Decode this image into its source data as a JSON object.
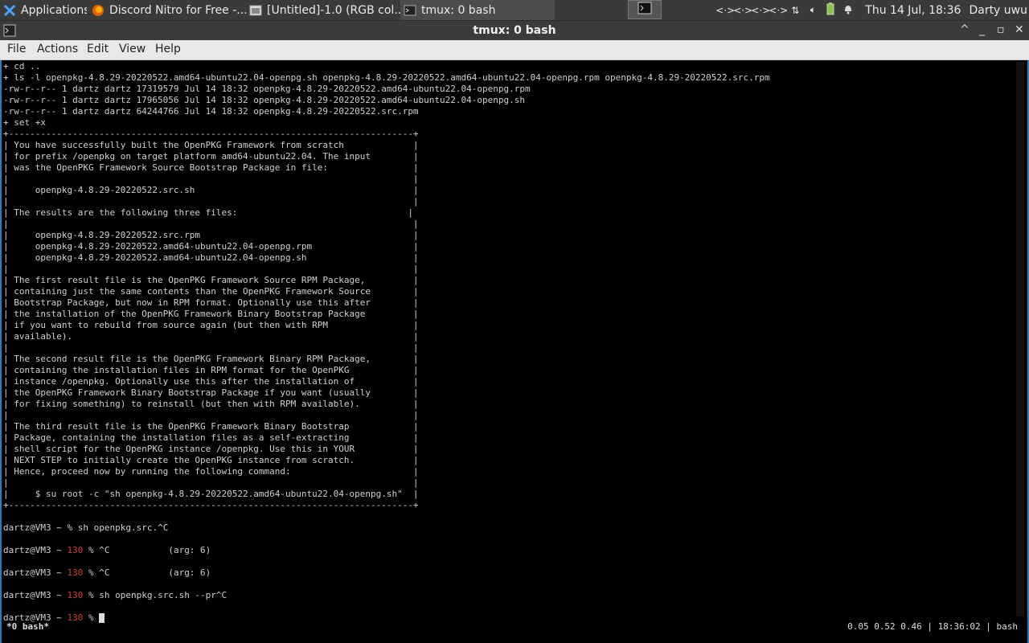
{
  "panel": {
    "tasks": [
      {
        "label": "Applications"
      },
      {
        "label": "Discord Nitro for Free -..."
      },
      {
        "label": "[Untitled]-1.0 (RGB col..."
      },
      {
        "label": "tmux: 0 bash"
      }
    ],
    "clock": "Thu 14 Jul, 18:36",
    "user": "Darty uwu"
  },
  "window": {
    "title": "tmux: 0 bash",
    "menu": [
      "File",
      "Actions",
      "Edit",
      "View",
      "Help"
    ]
  },
  "terminal": {
    "lines": [
      "+ cd ..",
      "+ ls -l openpkg-4.8.29-20220522.amd64-ubuntu22.04-openpg.sh openpkg-4.8.29-20220522.amd64-ubuntu22.04-openpg.rpm openpkg-4.8.29-20220522.src.rpm",
      "-rw-r--r-- 1 dartz dartz 17319579 Jul 14 18:32 openpkg-4.8.29-20220522.amd64-ubuntu22.04-openpg.rpm",
      "-rw-r--r-- 1 dartz dartz 17965056 Jul 14 18:32 openpkg-4.8.29-20220522.amd64-ubuntu22.04-openpg.sh",
      "-rw-r--r-- 1 dartz dartz 64244766 Jul 14 18:32 openpkg-4.8.29-20220522.src.rpm",
      "+ set +x",
      "+----------------------------------------------------------------------------+",
      "| You have successfully built the OpenPKG Framework from scratch             |",
      "| for prefix /openpkg on target platform amd64-ubuntu22.04. The input        |",
      "| was the OpenPKG Framework Source Bootstrap Package in file:                |",
      "|                                                                            |",
      "|     openpkg-4.8.29-20220522.src.sh                                         |",
      "|                                                                            |",
      "| The results are the following three files:                                |",
      "|                                                                            |",
      "|     openpkg-4.8.29-20220522.src.rpm                                        |",
      "|     openpkg-4.8.29-20220522.amd64-ubuntu22.04-openpg.rpm                   |",
      "|     openpkg-4.8.29-20220522.amd64-ubuntu22.04-openpg.sh                    |",
      "|                                                                            |",
      "| The first result file is the OpenPKG Framework Source RPM Package,         |",
      "| containing just the same contents than the OpenPKG Framework Source        |",
      "| Bootstrap Package, but now in RPM format. Optionally use this after        |",
      "| the installation of the OpenPKG Framework Binary Bootstrap Package         |",
      "| if you want to rebuild from source again (but then with RPM                |",
      "| available).                                                                |",
      "|                                                                            |",
      "| The second result file is the OpenPKG Framework Binary RPM Package,        |",
      "| containing the installation files in RPM format for the OpenPKG            |",
      "| instance /openpkg. Optionally use this after the installation of           |",
      "| the OpenPKG Framework Binary Bootstrap Package if you want (usually        |",
      "| for fixing something) to reinstall (but then with RPM available).          |",
      "|                                                                            |",
      "| The third result file is the OpenPKG Framework Binary Bootstrap            |",
      "| Package, containing the installation files as a self-extracting            |",
      "| shell script for the OpenPKG instance /openpkg. Use this in YOUR           |",
      "| NEXT STEP to initially create the OpenPKG instance from scratch.           |",
      "| Hence, proceed now by running the following command:                       |",
      "|                                                                            |",
      "|     $ su root -c \"sh openpkg-4.8.29-20220522.amd64-ubuntu22.04-openpg.sh\"  |",
      "+----------------------------------------------------------------------------+"
    ],
    "prompts": [
      {
        "prefix": "dartz@VM3 ~ ",
        "code": "",
        "tail": "% sh openpkg.src.^C"
      },
      {
        "prefix": "dartz@VM3 ~ ",
        "code": "130",
        "tail": " % ^C           (arg: 6)"
      },
      {
        "prefix": "dartz@VM3 ~ ",
        "code": "130",
        "tail": " % ^C           (arg: 6)"
      },
      {
        "prefix": "dartz@VM3 ~ ",
        "code": "130",
        "tail": " % sh openpkg.src.sh --pr^C"
      },
      {
        "prefix": "dartz@VM3 ~ ",
        "code": "130",
        "tail": " % "
      }
    ],
    "status_left": " *0 bash*",
    "status_right": "0.05 0.52 0.46 | 18:36:02 | bash"
  },
  "colors": {
    "prompt_code": "#d43a3a",
    "accent": "#2e7abf"
  }
}
